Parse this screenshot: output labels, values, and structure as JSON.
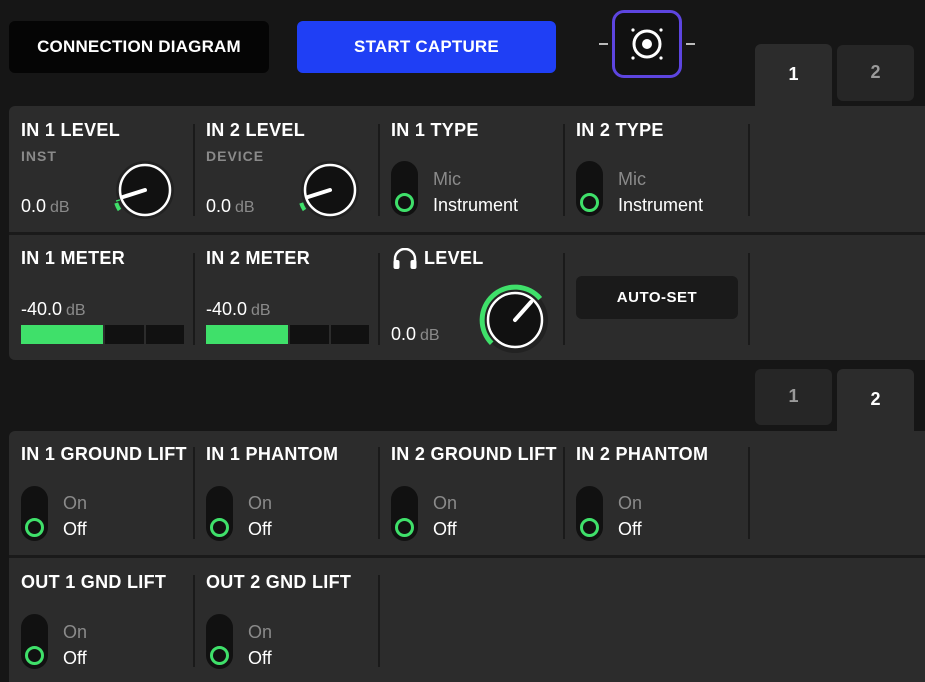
{
  "toolbar": {
    "connection_diagram": "CONNECTION DIAGRAM",
    "start_capture": "START CAPTURE"
  },
  "section1": {
    "tabs": [
      "1",
      "2"
    ],
    "active_tab": "1",
    "in1_level": {
      "title": "IN 1 LEVEL",
      "subtitle": "INST",
      "value": "0.0",
      "unit": "dB"
    },
    "in2_level": {
      "title": "IN 2 LEVEL",
      "subtitle": "DEVICE",
      "value": "0.0",
      "unit": "dB"
    },
    "in1_type": {
      "title": "IN 1 TYPE",
      "options": [
        "Mic",
        "Instrument"
      ],
      "selected": "Instrument"
    },
    "in2_type": {
      "title": "IN 2 TYPE",
      "options": [
        "Mic",
        "Instrument"
      ],
      "selected": "Instrument"
    },
    "in1_meter": {
      "title": "IN 1 METER",
      "value": "-40.0",
      "unit": "dB"
    },
    "in2_meter": {
      "title": "IN 2 METER",
      "value": "-40.0",
      "unit": "dB"
    },
    "headphone_level": {
      "title": "LEVEL",
      "value": "0.0",
      "unit": "dB"
    },
    "autoset": "AUTO-SET"
  },
  "section2": {
    "tabs": [
      "1",
      "2"
    ],
    "active_tab": "2",
    "in1_ground_lift": {
      "title": "IN 1 GROUND LIFT",
      "options": [
        "On",
        "Off"
      ],
      "selected": "Off"
    },
    "in1_phantom": {
      "title": "IN 1 PHANTOM",
      "options": [
        "On",
        "Off"
      ],
      "selected": "Off"
    },
    "in2_ground_lift": {
      "title": "IN 2 GROUND LIFT",
      "options": [
        "On",
        "Off"
      ],
      "selected": "Off"
    },
    "in2_phantom": {
      "title": "IN 2 PHANTOM",
      "options": [
        "On",
        "Off"
      ],
      "selected": "Off"
    },
    "out1_gnd_lift": {
      "title": "OUT 1 GND LIFT",
      "options": [
        "On",
        "Off"
      ],
      "selected": "Off"
    },
    "out2_gnd_lift": {
      "title": "OUT 2 GND LIFT",
      "options": [
        "On",
        "Off"
      ],
      "selected": "Off"
    }
  },
  "colors": {
    "accent_green": "#3fe06a",
    "start_blue": "#1f3ff5",
    "icon_border": "#5d45e0"
  },
  "icons": [
    "capture-target-icon",
    "headphones-icon"
  ]
}
